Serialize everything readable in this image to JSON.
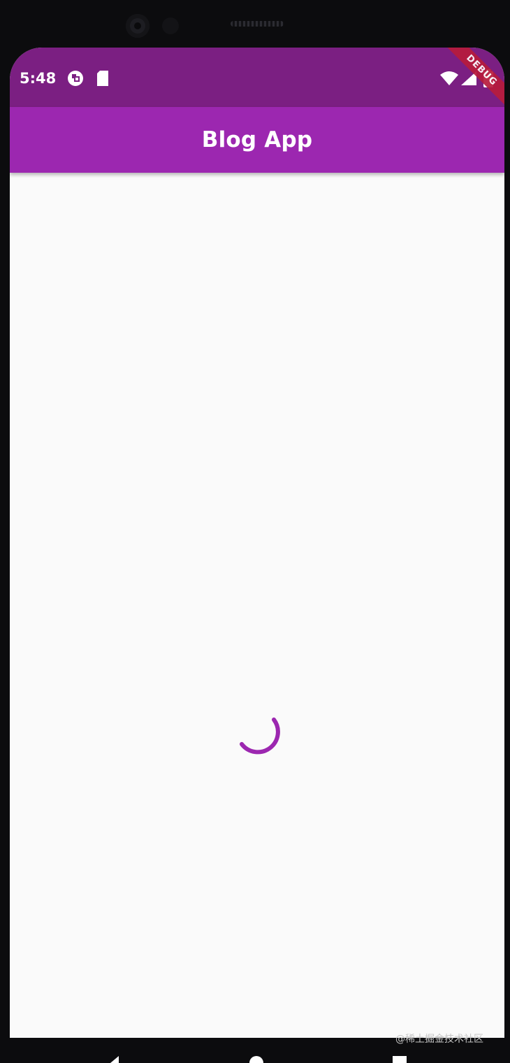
{
  "status_bar": {
    "time": "5:48",
    "icons": [
      "record-icon",
      "sd-card-icon",
      "wifi-icon",
      "signal-icon",
      "battery-icon"
    ],
    "color": "#7b1f82"
  },
  "app_bar": {
    "title": "Blog App",
    "color": "#9c27b0"
  },
  "debug_banner": {
    "label": "DEBUG"
  },
  "content": {
    "state": "loading",
    "spinner_color": "#9c27b0"
  },
  "navigation": {
    "icons": [
      "back-icon",
      "home-icon",
      "recents-icon"
    ]
  },
  "watermark": {
    "text": "@稀土掘金技术社区"
  }
}
